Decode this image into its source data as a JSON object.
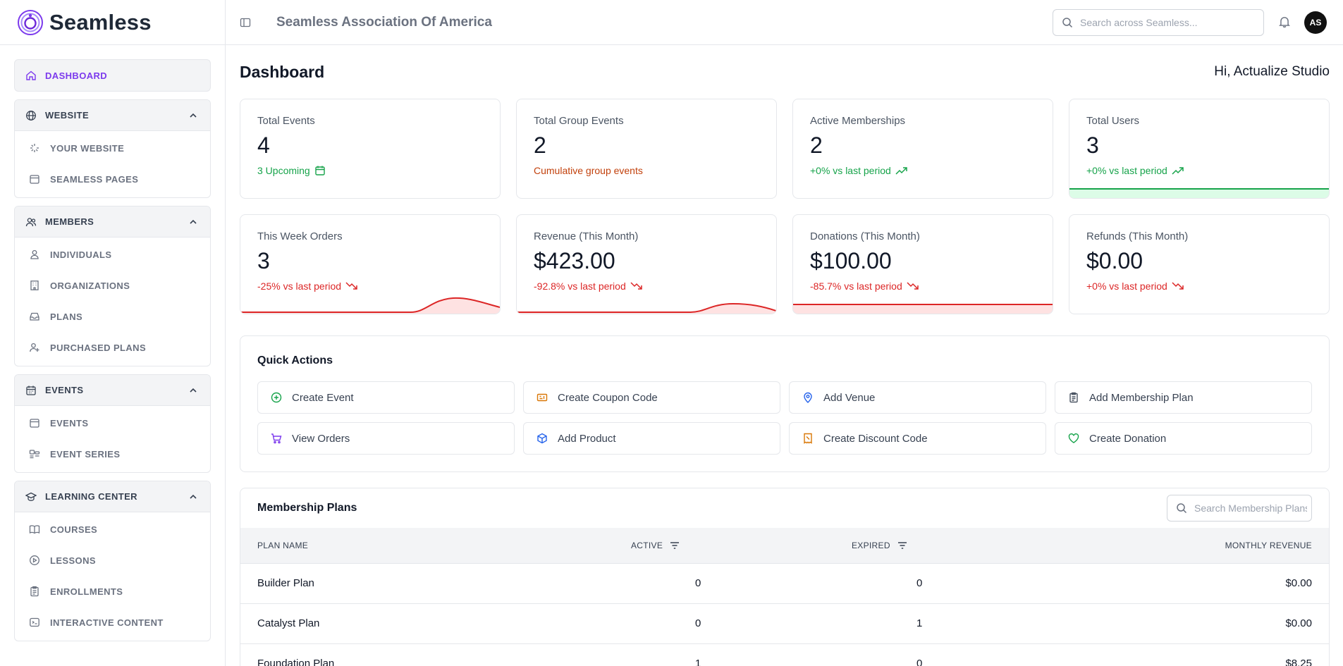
{
  "brand": {
    "name": "Seamless",
    "accent": "#7c3aed"
  },
  "header": {
    "org_name": "Seamless Association Of America",
    "search_placeholder": "Search across Seamless...",
    "avatar_initials": "AS"
  },
  "sidebar": {
    "dashboard": {
      "label": "DASHBOARD",
      "icon": "home-icon"
    },
    "groups": [
      {
        "label": "WEBSITE",
        "icon": "globe-icon",
        "items": [
          {
            "label": "YOUR WEBSITE",
            "icon": "sparkle-icon"
          },
          {
            "label": "SEAMLESS PAGES",
            "icon": "calendar-page-icon"
          }
        ]
      },
      {
        "label": "MEMBERS",
        "icon": "users-icon",
        "items": [
          {
            "label": "INDIVIDUALS",
            "icon": "user-icon"
          },
          {
            "label": "ORGANIZATIONS",
            "icon": "building-icon"
          },
          {
            "label": "PLANS",
            "icon": "tray-icon"
          },
          {
            "label": "PURCHASED PLANS",
            "icon": "user-plus-icon"
          }
        ]
      },
      {
        "label": "EVENTS",
        "icon": "calendar-icon",
        "items": [
          {
            "label": "EVENTS",
            "icon": "calendar-icon"
          },
          {
            "label": "EVENT SERIES",
            "icon": "series-icon"
          }
        ]
      },
      {
        "label": "LEARNING CENTER",
        "icon": "graduation-cap-icon",
        "items": [
          {
            "label": "COURSES",
            "icon": "book-icon"
          },
          {
            "label": "LESSONS",
            "icon": "play-circle-icon"
          },
          {
            "label": "ENROLLMENTS",
            "icon": "clipboard-icon"
          },
          {
            "label": "INTERACTIVE CONTENT",
            "icon": "interactive-icon"
          }
        ]
      }
    ]
  },
  "main": {
    "title": "Dashboard",
    "greeting": "Hi, Actualize Studio",
    "stats": [
      {
        "label": "Total Events",
        "value": "4",
        "sub": "3 Upcoming",
        "tone": "green",
        "icon": "calendar-icon"
      },
      {
        "label": "Total Group Events",
        "value": "2",
        "sub": "Cumulative group events",
        "tone": "orange",
        "icon": ""
      },
      {
        "label": "Active Memberships",
        "value": "2",
        "sub": "+0% vs last period",
        "tone": "green",
        "icon": "trend-up-icon"
      },
      {
        "label": "Total Users",
        "value": "3",
        "sub": "+0% vs last period",
        "tone": "green",
        "icon": "trend-up-icon"
      },
      {
        "label": "This Week Orders",
        "value": "3",
        "sub": "-25% vs last period",
        "tone": "red",
        "icon": "trend-down-icon"
      },
      {
        "label": "Revenue (This Month)",
        "value": "$423.00",
        "sub": "-92.8% vs last period",
        "tone": "red",
        "icon": "trend-down-icon"
      },
      {
        "label": "Donations (This Month)",
        "value": "$100.00",
        "sub": "-85.7% vs last period",
        "tone": "red",
        "icon": "trend-down-icon"
      },
      {
        "label": "Refunds (This Month)",
        "value": "$0.00",
        "sub": "+0% vs last period",
        "tone": "red",
        "icon": "trend-down-icon"
      }
    ],
    "quick_actions": {
      "title": "Quick Actions",
      "items": [
        {
          "label": "Create Event",
          "icon": "plus-circle-icon",
          "color": "#16a34a"
        },
        {
          "label": "Create Coupon Code",
          "icon": "ticket-icon",
          "color": "#d97706"
        },
        {
          "label": "Add Venue",
          "icon": "map-pin-icon",
          "color": "#2563eb"
        },
        {
          "label": "Add Membership Plan",
          "icon": "clipboard-icon",
          "color": "#4b5563"
        },
        {
          "label": "View Orders",
          "icon": "cart-icon",
          "color": "#7c3aed"
        },
        {
          "label": "Add Product",
          "icon": "box-icon",
          "color": "#2563eb"
        },
        {
          "label": "Create Discount Code",
          "icon": "receipt-icon",
          "color": "#d97706"
        },
        {
          "label": "Create Donation",
          "icon": "heart-icon",
          "color": "#16a34a"
        }
      ]
    },
    "membership_plans": {
      "title": "Membership Plans",
      "search_placeholder": "Search Membership Plans",
      "columns": [
        "PLAN NAME",
        "ACTIVE",
        "EXPIRED",
        "MONTHLY REVENUE"
      ],
      "rows": [
        {
          "name": "Builder Plan",
          "active": "0",
          "expired": "0",
          "revenue": "$0.00"
        },
        {
          "name": "Catalyst Plan",
          "active": "0",
          "expired": "1",
          "revenue": "$0.00"
        },
        {
          "name": "Foundation Plan",
          "active": "1",
          "expired": "0",
          "revenue": "$8.25"
        }
      ]
    }
  }
}
